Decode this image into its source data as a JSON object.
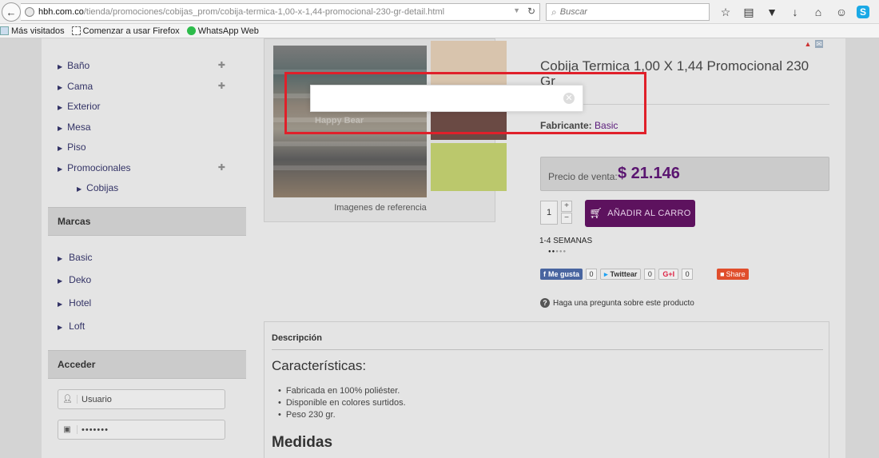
{
  "browser": {
    "url_host": "hbh.com.co",
    "url_path": "/tienda/promociones/cobijas_prom/cobija-termica-1,00-x-1,44-promocional-230-gr-detail.html",
    "search_placeholder": "Buscar",
    "bookmarks": [
      "Más visitados",
      "Comenzar a usar Firefox",
      "WhatsApp Web"
    ]
  },
  "sidebar": {
    "categories": [
      {
        "label": "Baño",
        "expandable": true
      },
      {
        "label": "Cama",
        "expandable": true
      },
      {
        "label": "Exterior",
        "expandable": false
      },
      {
        "label": "Mesa",
        "expandable": false
      },
      {
        "label": "Piso",
        "expandable": false
      },
      {
        "label": "Promocionales",
        "expandable": true
      },
      {
        "label": "Cobijas",
        "sub": true
      }
    ],
    "brands_heading": "Marcas",
    "brands": [
      "Basic",
      "Deko",
      "Hotel",
      "Loft"
    ],
    "login_heading": "Acceder",
    "username_placeholder": "Usuario",
    "password_value": "•••••••"
  },
  "product": {
    "image_caption": "Imagenes de referencia",
    "watermark": "Happy Bear",
    "title": "Cobija Termica 1,00 X 1,44 Promocional 230",
    "title_cont": "Gr",
    "manufacturer_label": "Fabricante:",
    "manufacturer_value": "Basic",
    "price_label": "Precio de venta:",
    "price_value": "$ 21.146",
    "quantity": "1",
    "qty_plus": "+",
    "qty_minus": "−",
    "add_to_cart": "AÑADIR AL CARRO",
    "availability": "1-4 SEMANAS",
    "availability_level": 0.4,
    "social": {
      "fb_label": "Me gusta",
      "fb_count": "0",
      "tw_label": "Twittear",
      "tw_count": "0",
      "gp_label": "G+I",
      "gp_count": "0",
      "share_label": "Share"
    },
    "ask_question": "Haga una pregunta sobre este producto"
  },
  "description": {
    "heading": "Descripción",
    "features_heading": "Características:",
    "features": [
      "Fabricada en 100% poliéster.",
      "Disponible en colores surtidos.",
      "Peso 230 gr."
    ],
    "measures_heading": "Medidas"
  },
  "colors": {
    "accent": "#5d125e",
    "highlight": "#e0202a"
  }
}
